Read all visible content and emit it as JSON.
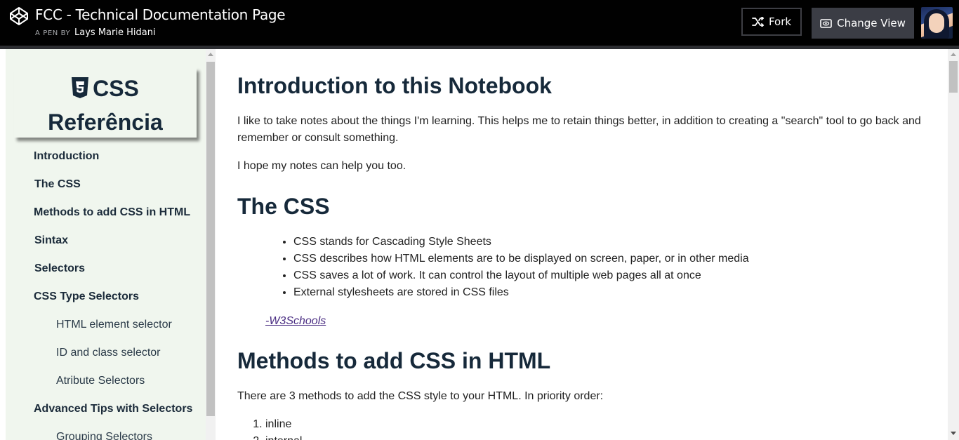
{
  "header": {
    "title": "FCC - Technical Documentation Page",
    "byline_prefix": "A PEN BY",
    "author": "Lays Marie Hidani",
    "fork_label": "Fork",
    "change_view_label": "Change View",
    "icons": [
      "codepen-logo-icon",
      "fork-icon",
      "eye-icon",
      "avatar"
    ]
  },
  "nav": {
    "header_text": "CSS Referência",
    "header_icon": "css3-logo-icon",
    "links": [
      {
        "label": "Introduction"
      },
      {
        "label": "The CSS"
      },
      {
        "label": "Methods to add CSS in HTML"
      },
      {
        "label": "Sintax"
      },
      {
        "label": "Selectors"
      },
      {
        "label": "CSS Type Selectors"
      },
      {
        "label": "HTML element selector"
      },
      {
        "label": "ID and class selector"
      },
      {
        "label": "Atribute Selectors"
      },
      {
        "label": "Advanced Tips with Selectors"
      },
      {
        "label": "Grouping Selectors"
      }
    ]
  },
  "content": {
    "intro": {
      "heading": "Introduction to this Notebook",
      "p1": "I like to take notes about the things I'm learning. This helps me to retain things better, in addition to creating a \"search\" tool to go back and remember or consult something.",
      "p2": "I hope my notes can help you too."
    },
    "css": {
      "heading": "The CSS",
      "bullets": [
        "CSS stands for Cascading Style Sheets",
        "CSS describes how HTML elements are to be displayed on screen, paper, or in other media",
        "CSS saves a lot of work. It can control the layout of multiple web pages all at once",
        "External stylesheets are stored in CSS files"
      ],
      "citation": "-W3Schools"
    },
    "methods": {
      "heading": "Methods to add CSS in HTML",
      "p1": "There are 3 methods to add the CSS style to your HTML. In priority order:",
      "items": [
        "inline",
        "internal"
      ]
    }
  },
  "colors": {
    "header_bg": "#010101",
    "nav_bg": "#f0f6ee",
    "heading": "#16293a",
    "link_visited": "#4b2e83",
    "button_bg": "#3b3d45"
  }
}
